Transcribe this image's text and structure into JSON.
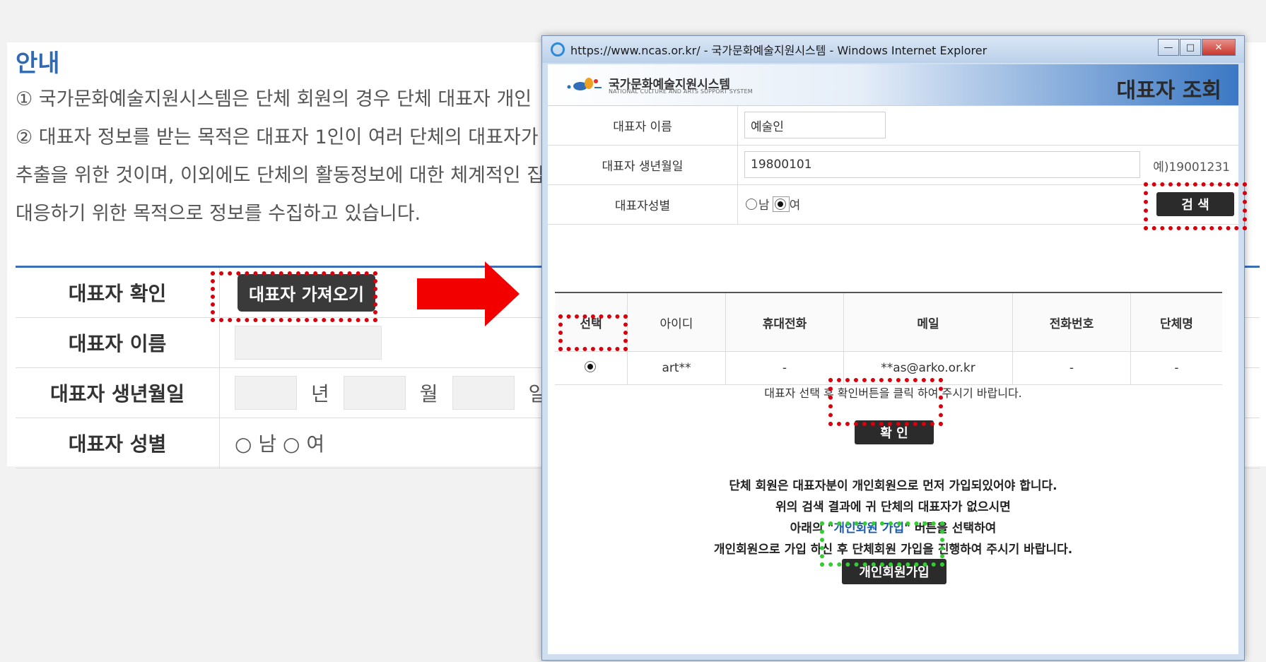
{
  "guide": {
    "title": "안내",
    "lines": [
      "① 국가문화예술지원시스템은 단체 회원의 경우 단체 대표자 개인",
      "② 대표자 정보를 받는 목적은 대표자 1인이 여러 단체의 대표자가",
      "추출을 위한 것이며, 이외에도 단체의 활동정보에 대한 체계적인 집",
      "대응하기 위한 목적으로 정보를 수집하고 있습니다."
    ]
  },
  "form": {
    "rep_check_label": "대표자 확인",
    "fetch_button": "대표자 가져오기",
    "rep_name_label": "대표자 이름",
    "rep_birth_label": "대표자 생년월일",
    "year_unit": "년",
    "month_unit": "월",
    "day_unit": "일",
    "rep_gender_label": "대표자 성별",
    "gender_text": "○ 남 ○ 여"
  },
  "popup": {
    "window_title": "https://www.ncas.or.kr/ - 국가문화예술지원시스템 - Windows Internet Explorer",
    "logo_kr": "국가문화예술지원시스템",
    "logo_en": "NATIONAL CULTURE AND ARTS SUPPORT SYSTEM",
    "header_title": "대표자 조회",
    "name_label": "대표자 이름",
    "name_value": "예술인",
    "birth_label": "대표자 생년월일",
    "birth_value": "19800101",
    "birth_hint": "예)19001231",
    "gender_label": "대표자성별",
    "gender_male": "남",
    "gender_female": "여",
    "search_button": "검 색",
    "table": {
      "headers": [
        "선택",
        "아이디",
        "휴대전화",
        "메일",
        "전화번호",
        "단체명"
      ],
      "row": {
        "id": "art**",
        "mobile": "-",
        "email": "**as@arko.or.kr",
        "phone": "-",
        "org": "-"
      }
    },
    "notice": "대표자 선택 후 확인버튼을 클릭 하여 주시기 바랍니다.",
    "ok_button": "확 인",
    "info_line1": "단체 회원은 대표자분이 개인회원으로 먼저 가입되있어야 합니다.",
    "info_line2": "위의 검색 결과에 귀 단체의 대표자가 없으시면",
    "info_line3_pre": "아래의 \"",
    "info_line3_hl": "개인회원 가입",
    "info_line3_post": "\" 버튼을 선택하여",
    "info_line4": "개인회원으로 가입 하신 후 단체회원 가입을 진행하여 주시기 바랍니다.",
    "join_button": "개인회원가입"
  },
  "colors": {
    "accent_blue": "#2f6ab3",
    "highlight_red": "#d8000c",
    "highlight_green": "#33cc33",
    "button_dark": "#2b2b2b"
  },
  "icons": [
    "ie-icon",
    "minimize-icon",
    "maximize-icon",
    "close-icon",
    "radio-icon",
    "arrow-right-icon",
    "logo-icon"
  ]
}
